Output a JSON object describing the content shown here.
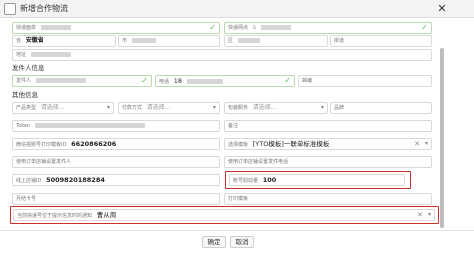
{
  "dialog": {
    "title": "新增合作物流"
  },
  "row1": {
    "logistics_number_label": "快递面单",
    "logistics_company_label": "快递网点",
    "logistics_company_value": "s"
  },
  "row2": {
    "province_value": "安徽省",
    "city_label": "市",
    "district_label": "区",
    "street_label": "街道"
  },
  "row3": {
    "address_label": "地址"
  },
  "sender_section": {
    "title": "发件人信息",
    "name_label": "发件人",
    "phone_label": "电话",
    "phone_value": "18",
    "postcode_label": "邮编"
  },
  "other_section": {
    "title": "其他信息",
    "product_type_label": "产品类型",
    "product_type_placeholder": "请选择...",
    "payment_label": "付款方式",
    "payment_placeholder": "请选择...",
    "package_label": "包装服务",
    "package_placeholder": "请选择...",
    "brand_label": "品牌",
    "token_label": "Token",
    "remark_label": "备注",
    "printer_id_label": "微信视频号打印模板ID",
    "printer_id_value": "6620866206",
    "template_label": "选择模板",
    "template_value": "[YTO模板]一联单标准模板",
    "order_user_label": "使用订单店铺设置发件人",
    "order_user_label2": "使用订单店铺设置发件电话",
    "online_id_label": "线上店铺ID",
    "online_id_value": "5009820188284",
    "shop_id_label": "账号助动量",
    "shop_id_value": "100",
    "monthly_label": "月结卡号",
    "print_template_label": "打印模板",
    "notify_label": "当前快递号位于提示信息时的通知",
    "notify_value": "曹从周"
  },
  "footer": {
    "ok_label": "确定",
    "cancel_label": "取消"
  },
  "icons": {
    "close": "close-icon",
    "check": "check-icon",
    "chevron": "chevron-down-icon",
    "clear": "clear-icon"
  },
  "colors": {
    "highlight_border": "#c9302c",
    "valid_check": "#5cb85c"
  }
}
